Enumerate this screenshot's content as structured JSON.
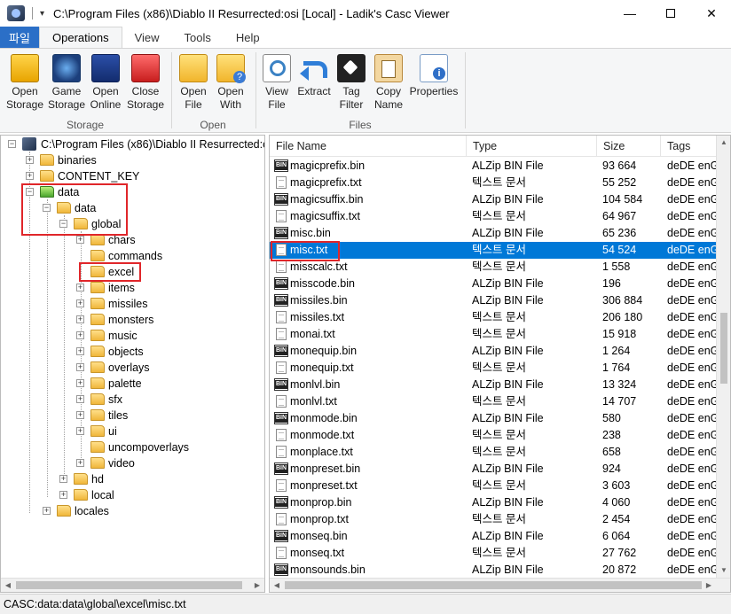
{
  "window": {
    "title": "C:\\Program Files (x86)\\Diablo II Resurrected:osi [Local] - Ladik's Casc Viewer",
    "minimize": "—",
    "close": "✕"
  },
  "qat": {
    "arrow": "▾"
  },
  "tabs": [
    {
      "label": "파일"
    },
    {
      "label": "Operations"
    },
    {
      "label": "View"
    },
    {
      "label": "Tools"
    },
    {
      "label": "Help"
    }
  ],
  "ribbon": {
    "storage": {
      "label": "Storage",
      "buttons": [
        {
          "line1": "Open",
          "line2": "Storage",
          "icon": "open-storage-icon"
        },
        {
          "line1": "Game",
          "line2": "Storage",
          "icon": "game-storage-icon"
        },
        {
          "line1": "Open",
          "line2": "Online",
          "icon": "open-online-icon"
        },
        {
          "line1": "Close",
          "line2": "Storage",
          "icon": "close-storage-icon"
        }
      ]
    },
    "open": {
      "label": "Open",
      "buttons": [
        {
          "line1": "Open",
          "line2": "File",
          "icon": "folder-open-icon"
        },
        {
          "line1": "Open",
          "line2": "With",
          "icon": "open-with-icon"
        }
      ]
    },
    "files": {
      "label": "Files",
      "buttons": [
        {
          "line1": "View",
          "line2": "File",
          "icon": "magnifier-icon"
        },
        {
          "line1": "Extract",
          "line2": "",
          "icon": "extract-arrow-icon"
        },
        {
          "line1": "Tag",
          "line2": "Filter",
          "icon": "tag-icon"
        },
        {
          "line1": "Copy",
          "line2": "Name",
          "icon": "copy-icon"
        },
        {
          "line1": "Properties",
          "line2": "",
          "icon": "properties-icon"
        }
      ]
    }
  },
  "tree": {
    "root": "C:\\Program Files (x86)\\Diablo II Resurrected:o",
    "items": [
      {
        "label": "binaries",
        "expander": "+"
      },
      {
        "label": "CONTENT_KEY",
        "expander": "+"
      },
      {
        "label": "data",
        "expander": "−"
      },
      {
        "label": "data",
        "expander": "−"
      },
      {
        "label": "global",
        "expander": "−"
      },
      {
        "label": "chars",
        "expander": "+"
      },
      {
        "label": "commands",
        "expander": ""
      },
      {
        "label": "excel",
        "expander": ""
      },
      {
        "label": "items",
        "expander": "+"
      },
      {
        "label": "missiles",
        "expander": "+"
      },
      {
        "label": "monsters",
        "expander": "+"
      },
      {
        "label": "music",
        "expander": "+"
      },
      {
        "label": "objects",
        "expander": "+"
      },
      {
        "label": "overlays",
        "expander": "+"
      },
      {
        "label": "palette",
        "expander": "+"
      },
      {
        "label": "sfx",
        "expander": "+"
      },
      {
        "label": "tiles",
        "expander": "+"
      },
      {
        "label": "ui",
        "expander": "+"
      },
      {
        "label": "uncompoverlays",
        "expander": ""
      },
      {
        "label": "video",
        "expander": "+"
      },
      {
        "label": "hd",
        "expander": "+"
      },
      {
        "label": "local",
        "expander": "+"
      },
      {
        "label": "locales",
        "expander": "+"
      }
    ]
  },
  "list": {
    "columns": {
      "name": "File Name",
      "type": "Type",
      "size": "Size",
      "tags": "Tags"
    },
    "rows": [
      {
        "name": "magicprefix.bin",
        "type": "ALZip BIN File",
        "size": "93 664",
        "tags": "deDE enG",
        "kind": "bin"
      },
      {
        "name": "magicprefix.txt",
        "type": "텍스트 문서",
        "size": "55 252",
        "tags": "deDE enG",
        "kind": "txt"
      },
      {
        "name": "magicsuffix.bin",
        "type": "ALZip BIN File",
        "size": "104 584",
        "tags": "deDE enG",
        "kind": "bin"
      },
      {
        "name": "magicsuffix.txt",
        "type": "텍스트 문서",
        "size": "64 967",
        "tags": "deDE enG",
        "kind": "txt"
      },
      {
        "name": "misc.bin",
        "type": "ALZip BIN File",
        "size": "65 236",
        "tags": "deDE enG",
        "kind": "bin"
      },
      {
        "name": "misc.txt",
        "type": "텍스트 문서",
        "size": "54 524",
        "tags": "deDE enG",
        "kind": "txt",
        "selected": true
      },
      {
        "name": "misscalc.txt",
        "type": "텍스트 문서",
        "size": "1 558",
        "tags": "deDE enG",
        "kind": "txt"
      },
      {
        "name": "misscode.bin",
        "type": "ALZip BIN File",
        "size": "196",
        "tags": "deDE enG",
        "kind": "bin"
      },
      {
        "name": "missiles.bin",
        "type": "ALZip BIN File",
        "size": "306 884",
        "tags": "deDE enG",
        "kind": "bin"
      },
      {
        "name": "missiles.txt",
        "type": "텍스트 문서",
        "size": "206 180",
        "tags": "deDE enG",
        "kind": "txt"
      },
      {
        "name": "monai.txt",
        "type": "텍스트 문서",
        "size": "15 918",
        "tags": "deDE enG",
        "kind": "txt"
      },
      {
        "name": "monequip.bin",
        "type": "ALZip BIN File",
        "size": "1 264",
        "tags": "deDE enG",
        "kind": "bin"
      },
      {
        "name": "monequip.txt",
        "type": "텍스트 문서",
        "size": "1 764",
        "tags": "deDE enG",
        "kind": "txt"
      },
      {
        "name": "monlvl.bin",
        "type": "ALZip BIN File",
        "size": "13 324",
        "tags": "deDE enG",
        "kind": "bin"
      },
      {
        "name": "monlvl.txt",
        "type": "텍스트 문서",
        "size": "14 707",
        "tags": "deDE enG",
        "kind": "txt"
      },
      {
        "name": "monmode.bin",
        "type": "ALZip BIN File",
        "size": "580",
        "tags": "deDE enG",
        "kind": "bin"
      },
      {
        "name": "monmode.txt",
        "type": "텍스트 문서",
        "size": "238",
        "tags": "deDE enG",
        "kind": "txt"
      },
      {
        "name": "monplace.txt",
        "type": "텍스트 문서",
        "size": "658",
        "tags": "deDE enG",
        "kind": "txt"
      },
      {
        "name": "monpreset.bin",
        "type": "ALZip BIN File",
        "size": "924",
        "tags": "deDE enG",
        "kind": "bin"
      },
      {
        "name": "monpreset.txt",
        "type": "텍스트 문서",
        "size": "3 603",
        "tags": "deDE enG",
        "kind": "txt"
      },
      {
        "name": "monprop.bin",
        "type": "ALZip BIN File",
        "size": "4 060",
        "tags": "deDE enG",
        "kind": "bin"
      },
      {
        "name": "monprop.txt",
        "type": "텍스트 문서",
        "size": "2 454",
        "tags": "deDE enG",
        "kind": "txt"
      },
      {
        "name": "monseq.bin",
        "type": "ALZip BIN File",
        "size": "6 064",
        "tags": "deDE enG",
        "kind": "bin"
      },
      {
        "name": "monseq.txt",
        "type": "텍스트 문서",
        "size": "27 762",
        "tags": "deDE enG",
        "kind": "txt"
      },
      {
        "name": "monsounds.bin",
        "type": "ALZip BIN File",
        "size": "20 872",
        "tags": "deDE enG",
        "kind": "bin"
      }
    ]
  },
  "statusbar": {
    "path": "CASC:data:data\\global\\excel\\misc.txt"
  },
  "colors": {
    "accent": "#2b6fc7",
    "selection": "#0078d7",
    "highlight": "#e0262a"
  }
}
